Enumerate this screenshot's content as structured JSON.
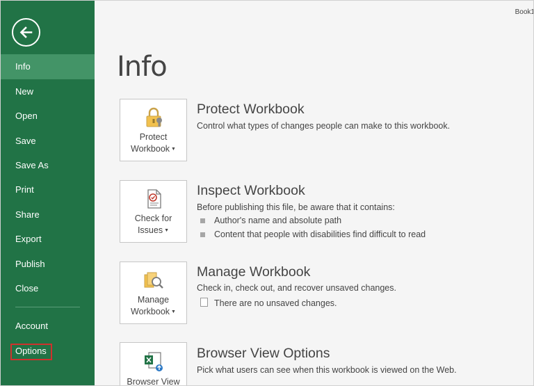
{
  "window": {
    "book_name": "Book1"
  },
  "sidebar": {
    "items": [
      {
        "label": "Info"
      },
      {
        "label": "New"
      },
      {
        "label": "Open"
      },
      {
        "label": "Save"
      },
      {
        "label": "Save As"
      },
      {
        "label": "Print"
      },
      {
        "label": "Share"
      },
      {
        "label": "Export"
      },
      {
        "label": "Publish"
      },
      {
        "label": "Close"
      },
      {
        "label": "Account"
      },
      {
        "label": "Options"
      }
    ],
    "active": "Info",
    "highlighted": "Options",
    "colors": {
      "background": "#217346",
      "active": "#439467",
      "highlight_border": "#d0312d"
    }
  },
  "main": {
    "title": "Info",
    "sections": [
      {
        "tile_line1": "Protect",
        "tile_line2": "Workbook",
        "title": "Protect Workbook",
        "description": "Control what types of changes people can make to this workbook.",
        "icon": "lock-icon"
      },
      {
        "tile_line1": "Check for",
        "tile_line2": "Issues",
        "title": "Inspect Workbook",
        "description": "Before publishing this file, be aware that it contains:",
        "bullets": [
          "Author's name and absolute path",
          "Content that people with disabilities find difficult to read"
        ],
        "icon": "document-check-icon"
      },
      {
        "tile_line1": "Manage",
        "tile_line2": "Workbook",
        "title": "Manage Workbook",
        "description": "Check in, check out, and recover unsaved changes.",
        "note": "There are no unsaved changes.",
        "icon": "manage-workbook-icon"
      },
      {
        "tile_line1": "Browser View",
        "title": "Browser View Options",
        "description": "Pick what users can see when this workbook is viewed on the Web.",
        "icon": "excel-browser-icon"
      }
    ]
  }
}
